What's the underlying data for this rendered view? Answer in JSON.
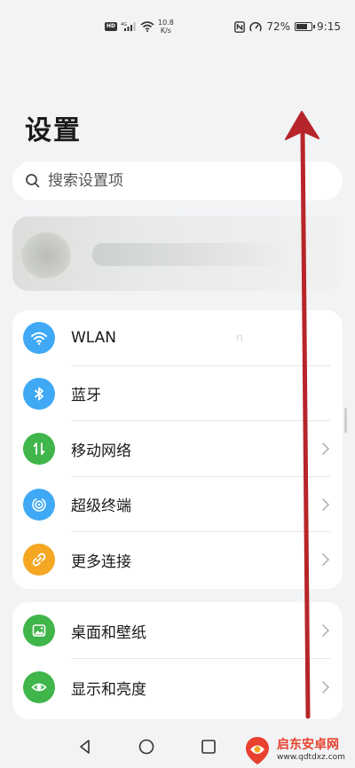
{
  "status_bar": {
    "hd": "HD",
    "network_type": "4G",
    "speed_value": "10.8",
    "speed_unit": "K/s",
    "battery_percent": "72%",
    "battery_level": 0.72,
    "time": "9:15"
  },
  "page": {
    "title": "设置"
  },
  "search": {
    "placeholder": "搜索设置项"
  },
  "settings_groups": [
    {
      "items": [
        {
          "label": "WLAN",
          "value": "n",
          "icon": "wifi-icon",
          "color": "#3fa9f5"
        },
        {
          "label": "蓝牙",
          "icon": "bluetooth-icon",
          "color": "#3fa9f5"
        },
        {
          "label": "移动网络",
          "icon": "mobile-data-icon",
          "color": "#3fb54a"
        },
        {
          "label": "超级终端",
          "icon": "super-device-icon",
          "color": "#3fa9f5"
        },
        {
          "label": "更多连接",
          "icon": "link-icon",
          "color": "#f5a623"
        }
      ]
    },
    {
      "items": [
        {
          "label": "桌面和壁纸",
          "icon": "wallpaper-icon",
          "color": "#3fb54a"
        },
        {
          "label": "显示和亮度",
          "icon": "eye-icon",
          "color": "#3fb54a"
        }
      ]
    }
  ],
  "watermark": {
    "title": "启东安卓网",
    "url": "www.qdtdxz.com"
  },
  "colors": {
    "annotation_arrow": "#b7252a",
    "background": "#f1f3f5"
  }
}
